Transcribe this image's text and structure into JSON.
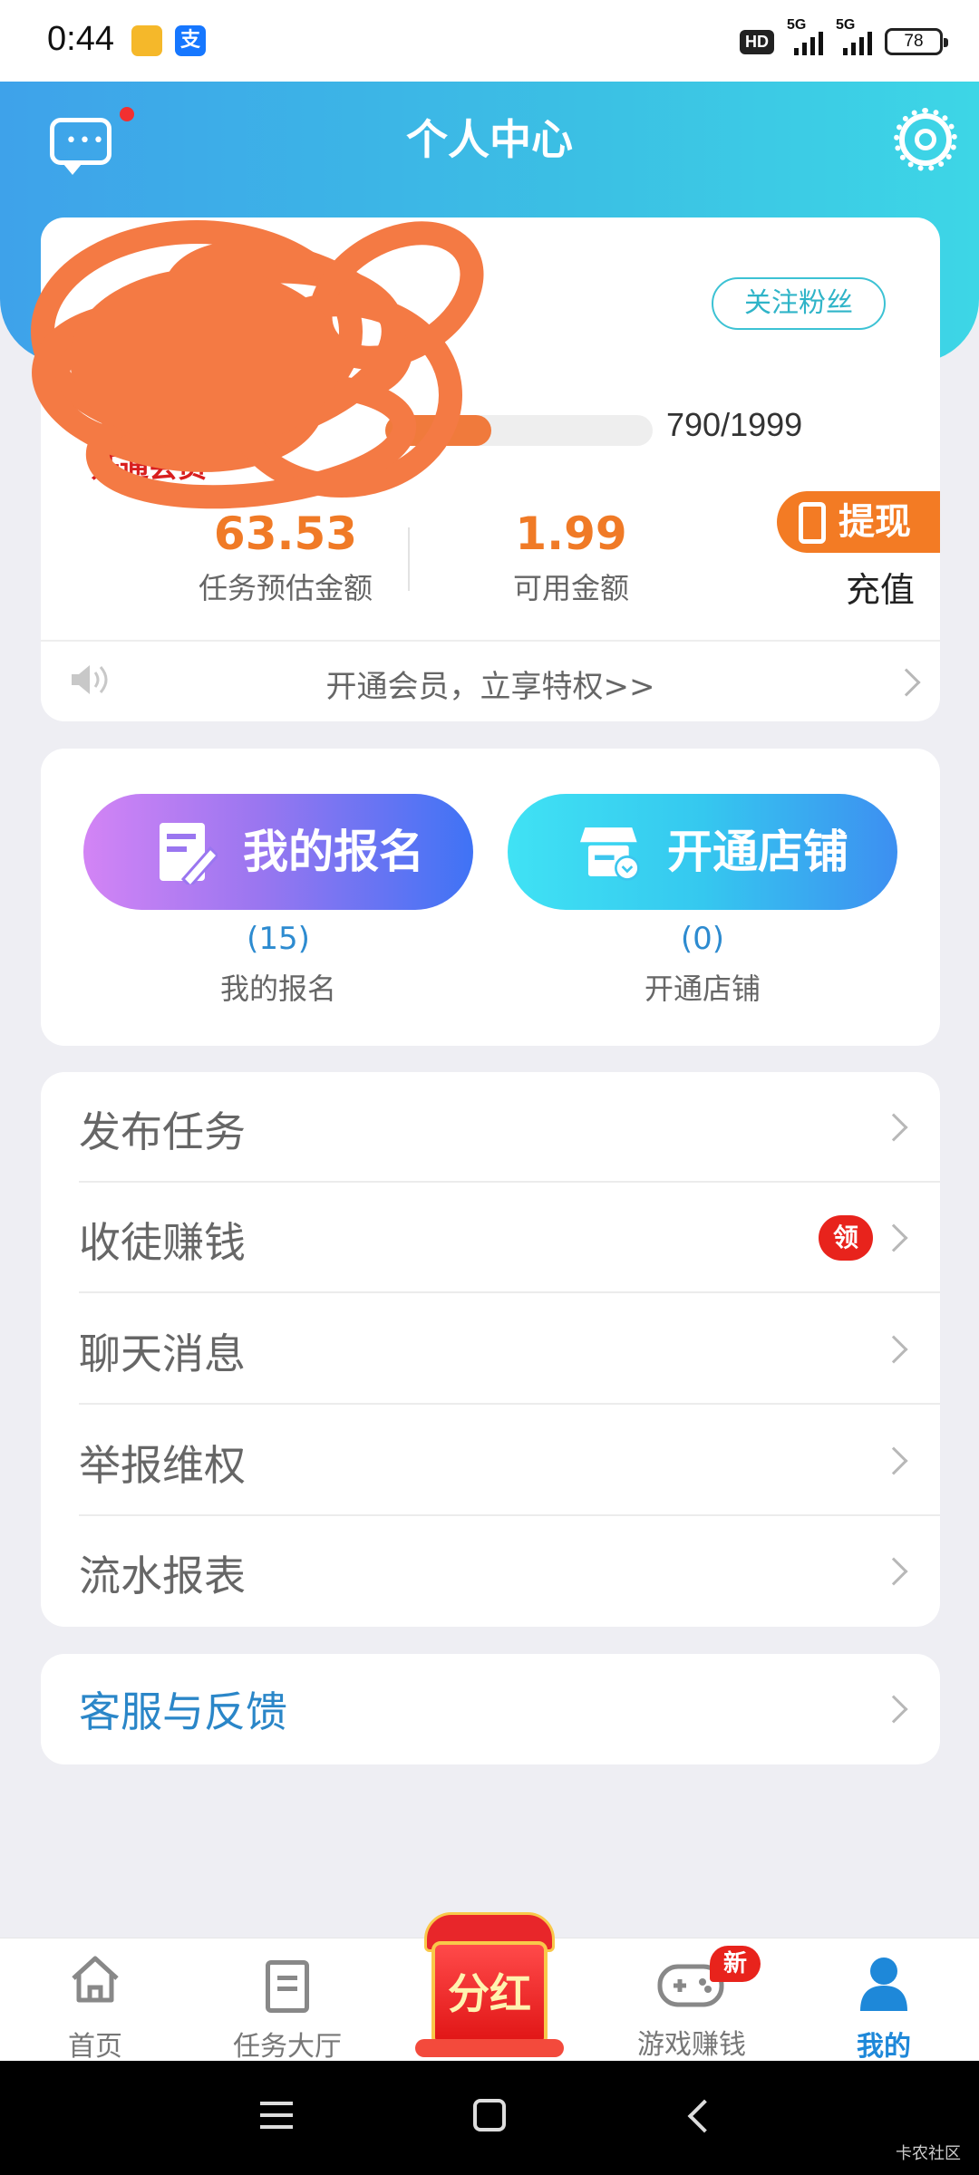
{
  "status_bar": {
    "time": "0:44",
    "network_hd": "HD",
    "network_1": "5G",
    "network_2": "5G",
    "battery": "78",
    "alipay_glyph": "支"
  },
  "header": {
    "title": "个人中心",
    "message_icon": "chat-bubble-icon",
    "settings_icon": "gear-icon",
    "unread_dot_color": "#f23030"
  },
  "profile": {
    "follow_button": "关注粉丝",
    "member_text": "开通会员",
    "progress": {
      "current": 790,
      "max": 1999,
      "text": "790/1999"
    },
    "task_estimate": {
      "value": "63.53",
      "label": "任务预估金额"
    },
    "available": {
      "value": "1.99",
      "label": "可用金额"
    },
    "withdraw_button": "提现",
    "recharge_link": "充值",
    "notice": "开通会员，立享特权>>"
  },
  "signup": {
    "my_signup": {
      "button": "我的报名",
      "count": "(15)",
      "label": "我的报名"
    },
    "open_shop": {
      "button": "开通店铺",
      "count": "(0)",
      "label": "开通店铺"
    }
  },
  "menu": {
    "items": [
      {
        "label": "发布任务"
      },
      {
        "label": "收徒赚钱",
        "badge": "领"
      },
      {
        "label": "聊天消息"
      },
      {
        "label": "举报维权"
      },
      {
        "label": "流水报表"
      }
    ],
    "service": "客服与反馈"
  },
  "bottom_nav": {
    "items": [
      {
        "label": "首页",
        "icon": "home-icon"
      },
      {
        "label": "任务大厅",
        "icon": "document-icon"
      },
      {
        "label": "分红",
        "icon": "red-envelope-icon"
      },
      {
        "label": "游戏赚钱",
        "icon": "gamepad-icon",
        "badge": "新"
      },
      {
        "label": "我的",
        "icon": "person-icon",
        "active": true
      }
    ],
    "active_color": "#1e88d9"
  },
  "watermark": "卡农社区",
  "colors": {
    "accent_orange": "#f07a26",
    "header_gradient_start": "#3ea2ea",
    "header_gradient_end": "#3dd6e6",
    "link_blue": "#2a86c8"
  }
}
